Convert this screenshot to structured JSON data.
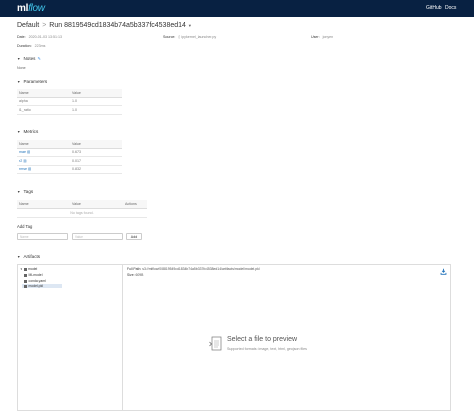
{
  "nav": {
    "logo_ml": "ml",
    "logo_flow": "flow",
    "github": "GitHub",
    "docs": "Docs"
  },
  "header": {
    "breadcrumb": "Default",
    "separator": ">",
    "run_title": "Run 8819549cd1834b74a5b337fc4538ed14"
  },
  "meta": {
    "date_label": "Date:",
    "date_value": "2020-01-03 13:51:13",
    "source_label": "Source:",
    "source_value": "ipykernel_launcher.py",
    "user_label": "User:",
    "user_value": "jonyen",
    "duration_label": "Duration:",
    "duration_value": "223ms"
  },
  "notes": {
    "title": "Notes",
    "value": "None"
  },
  "parameters": {
    "title": "Parameters",
    "columns": [
      "Name",
      "Value"
    ],
    "rows": [
      {
        "name": "alpha",
        "value": "1.0"
      },
      {
        "name": "l1_ratio",
        "value": "1.0"
      }
    ]
  },
  "metrics": {
    "title": "Metrics",
    "columns": [
      "Name",
      "Value"
    ],
    "rows": [
      {
        "name": "mae",
        "value": "0.673"
      },
      {
        "name": "r2",
        "value": "0.017"
      },
      {
        "name": "rmse",
        "value": "0.832"
      }
    ]
  },
  "tags": {
    "title": "Tags",
    "columns": [
      "Name",
      "Value",
      "Actions"
    ],
    "empty": "No tags found.",
    "add_title": "Add Tag",
    "name_placeholder": "Name",
    "value_placeholder": "Value",
    "add_button": "Add"
  },
  "artifacts": {
    "title": "Artifacts",
    "tree": [
      {
        "label": "model",
        "level": 0
      },
      {
        "label": "MLmodel",
        "level": 1
      },
      {
        "label": "conda.yaml",
        "level": 1
      },
      {
        "label": "model.pkl",
        "level": 1
      }
    ],
    "full_path_label": "Full Path:",
    "full_path_value": "s3://mlflow/0/8819549cd1834b74a5b337fc4538ed14/artifacts/model/model.pkl",
    "size_label": "Size:",
    "size_value": "609B",
    "preview_title": "Select a file to preview",
    "preview_sub": "Supported formats: image, text, html, geojson files"
  },
  "colors": {
    "navbar": "#082142",
    "accent": "#43c9ed",
    "link": "#2374bb"
  }
}
